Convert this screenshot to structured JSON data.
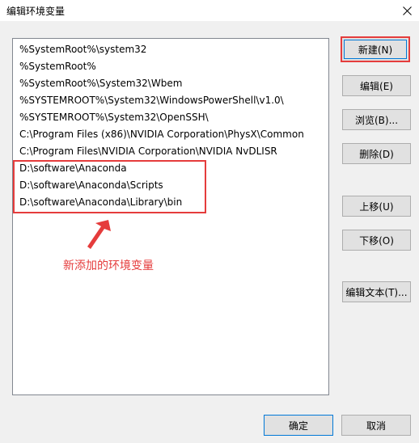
{
  "window": {
    "title": "编辑环境变量",
    "close_icon": "close-icon"
  },
  "list": {
    "items": [
      "%SystemRoot%\\system32",
      "%SystemRoot%",
      "%SystemRoot%\\System32\\Wbem",
      "%SYSTEMROOT%\\System32\\WindowsPowerShell\\v1.0\\",
      "%SYSTEMROOT%\\System32\\OpenSSH\\",
      "C:\\Program Files (x86)\\NVIDIA Corporation\\PhysX\\Common",
      "C:\\Program Files\\NVIDIA Corporation\\NVIDIA NvDLISR",
      "D:\\software\\Anaconda",
      "D:\\software\\Anaconda\\Scripts",
      "D:\\software\\Anaconda\\Library\\bin"
    ]
  },
  "annotation": {
    "text": "新添加的环境变量",
    "color": "#e53c3c"
  },
  "buttons": {
    "new": "新建(N)",
    "edit": "编辑(E)",
    "browse": "浏览(B)...",
    "delete": "删除(D)",
    "move_up": "上移(U)",
    "move_down": "下移(O)",
    "edit_text": "编辑文本(T)...",
    "ok": "确定",
    "cancel": "取消"
  },
  "colors": {
    "accent": "#0078d7",
    "highlight": "#e53c3c"
  }
}
